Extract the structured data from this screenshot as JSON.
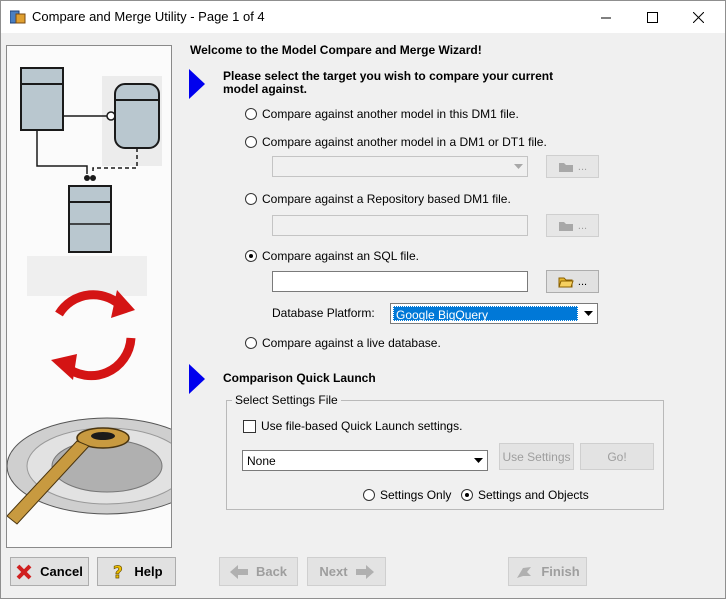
{
  "window": {
    "title": "Compare and Merge Utility  - Page 1 of 4",
    "minimize_glyph": "—",
    "maximize_glyph": "☐",
    "close_glyph": "✕"
  },
  "wizard": {
    "welcome": "Welcome to the Model Compare and Merge Wizard!",
    "target_heading_line1": "Please select the target you wish to compare your current",
    "target_heading_line2": "model against.",
    "options": {
      "opt1": "Compare against another model in this DM1 file.",
      "opt2": "Compare against another model in a DM1 or DT1 file.",
      "opt3": "Compare against a Repository based DM1 file.",
      "opt4": "Compare against an SQL file.",
      "opt5": "Compare against a live database."
    },
    "selected_option": "opt4",
    "browse_label": "...",
    "sql_file_value": "",
    "db_platform_label": "Database Platform:",
    "db_platform_value": "Google BigQuery"
  },
  "quick_launch": {
    "heading": "Comparison Quick Launch",
    "group_title": "Select Settings File",
    "checkbox_label": "Use file-based Quick Launch settings.",
    "settings_value": "None",
    "use_settings_label": "Use Settings",
    "go_label": "Go!",
    "settings_only_label": "Settings Only",
    "settings_and_objects_label": "Settings and Objects",
    "selected_scope": "settings_and_objects"
  },
  "footer": {
    "cancel_label": "Cancel",
    "help_label": "Help",
    "back_label": "Back",
    "next_label": "Next",
    "finish_label": "Finish"
  },
  "colors": {
    "arrow_blue": "#0000ee",
    "selection_blue": "#0078d7",
    "cancel_red": "#d02020",
    "help_yellow": "#f0c000"
  },
  "icons": {
    "app": "compare-app-icon",
    "folder": "folder-icon",
    "cancel": "x-icon",
    "help": "question-icon",
    "back": "left-arrow-icon",
    "next": "right-arrow-icon",
    "finish": "finish-flag-icon"
  }
}
